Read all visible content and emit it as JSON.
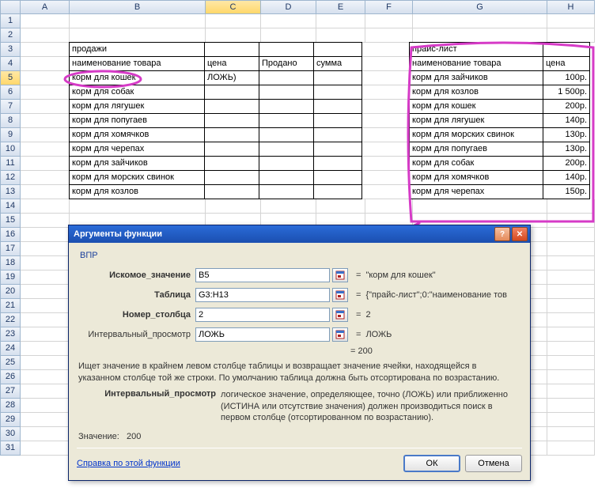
{
  "columns": [
    "A",
    "B",
    "C",
    "D",
    "E",
    "F",
    "G",
    "H"
  ],
  "rowcount": 31,
  "selectedCol": "C",
  "selectedRow": 5,
  "sales": {
    "title": "продажи",
    "h_name": "наименование товара",
    "h_price": "цена",
    "h_sold": "Продано",
    "h_sum": "сумма",
    "c5": "ЛОЖЬ)",
    "items": [
      "корм для кошек",
      "корм для собак",
      "корм для лягушек",
      "корм для попугаев",
      "корм для хомячков",
      "корм для черепах",
      "корм для зайчиков",
      "корм для морских свинок",
      "корм для козлов"
    ]
  },
  "price": {
    "title": "прайс-лист",
    "h_name": "наименование товара",
    "h_price": "цена",
    "rows": [
      {
        "n": "корм для зайчиков",
        "p": "100р."
      },
      {
        "n": "корм для козлов",
        "p": "1 500р."
      },
      {
        "n": "корм для кошек",
        "p": "200р."
      },
      {
        "n": "корм для лягушек",
        "p": "140р."
      },
      {
        "n": "корм для морских свинок",
        "p": "130р."
      },
      {
        "n": "корм для попугаев",
        "p": "130р."
      },
      {
        "n": "корм для собак",
        "p": "200р."
      },
      {
        "n": "корм для хомячков",
        "p": "140р."
      },
      {
        "n": "корм для черепах",
        "p": "150р."
      }
    ]
  },
  "dialog": {
    "title": "Аргументы функции",
    "func": "ВПР",
    "args": {
      "lookup_lbl": "Искомое_значение",
      "lookup_val": "B5",
      "lookup_preview": "\"корм для кошек\"",
      "table_lbl": "Таблица",
      "table_val": "G3:H13",
      "table_preview": "{\"прайс-лист\";0:\"наименование тов",
      "col_lbl": "Номер_столбца",
      "col_val": "2",
      "col_preview": "2",
      "range_lbl": "Интервальный_просмотр",
      "range_val": "ЛОЖЬ",
      "range_preview": "ЛОЖЬ"
    },
    "result_eq": "=  200",
    "desc": "Ищет значение в крайнем левом столбце таблицы и возвращает значение ячейки, находящейся в указанном столбце той же строки. По умолчанию таблица должна быть отсортирована по возрастанию.",
    "argname": "Интервальный_просмотр",
    "argdesc": "логическое значение, определяющее, точно (ЛОЖЬ) или приближенно (ИСТИНА или отсутствие значения) должен производиться поиск в первом столбце (отсортированном по возрастанию).",
    "value_lbl": "Значение:",
    "value": "200",
    "help": "Справка по этой функции",
    "ok": "ОК",
    "cancel": "Отмена"
  }
}
